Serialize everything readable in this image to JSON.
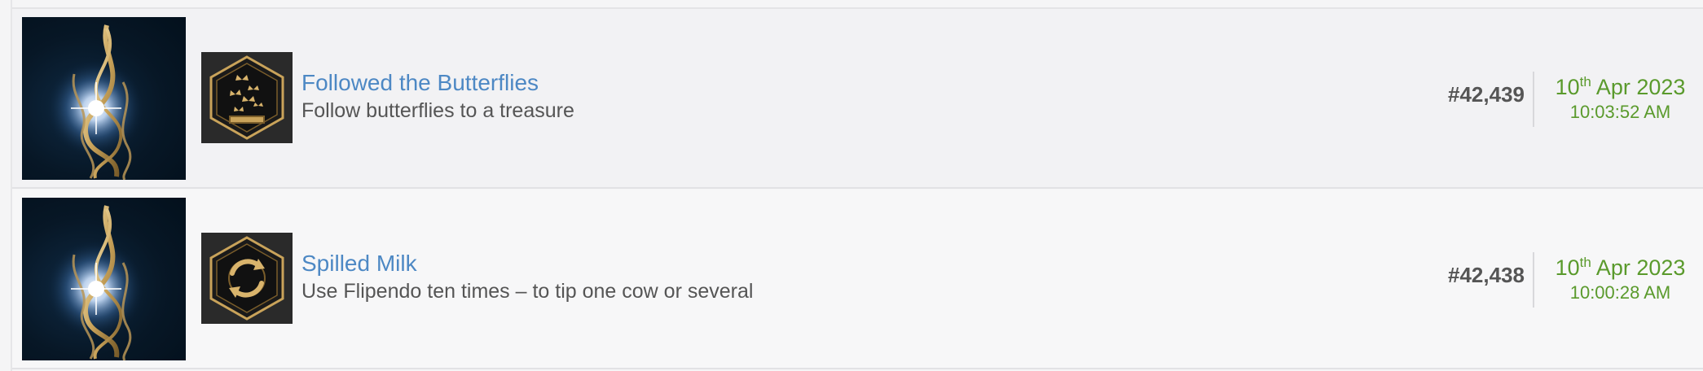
{
  "entries": [
    {
      "game_icon": "hogwarts-legacy-game-art",
      "achievement_icon": "butterflies-icon",
      "title": "Followed the Butterflies",
      "description": "Follow butterflies to a treasure",
      "rank": "#42,439",
      "date_day": "10",
      "date_suffix": "th",
      "date_rest": "Apr 2023",
      "time": "10:03:52 AM"
    },
    {
      "game_icon": "hogwarts-legacy-game-art",
      "achievement_icon": "flipendo-icon",
      "title": "Spilled Milk",
      "description": "Use Flipendo ten times – to tip one cow or several",
      "rank": "#42,438",
      "date_day": "10",
      "date_suffix": "th",
      "date_rest": "Apr 2023",
      "time": "10:00:28 AM"
    }
  ],
  "colors": {
    "title_link": "#4d88c4",
    "date_green": "#5a9a2c",
    "text_gray": "#555555",
    "icon_gold": "#c9a35a"
  }
}
